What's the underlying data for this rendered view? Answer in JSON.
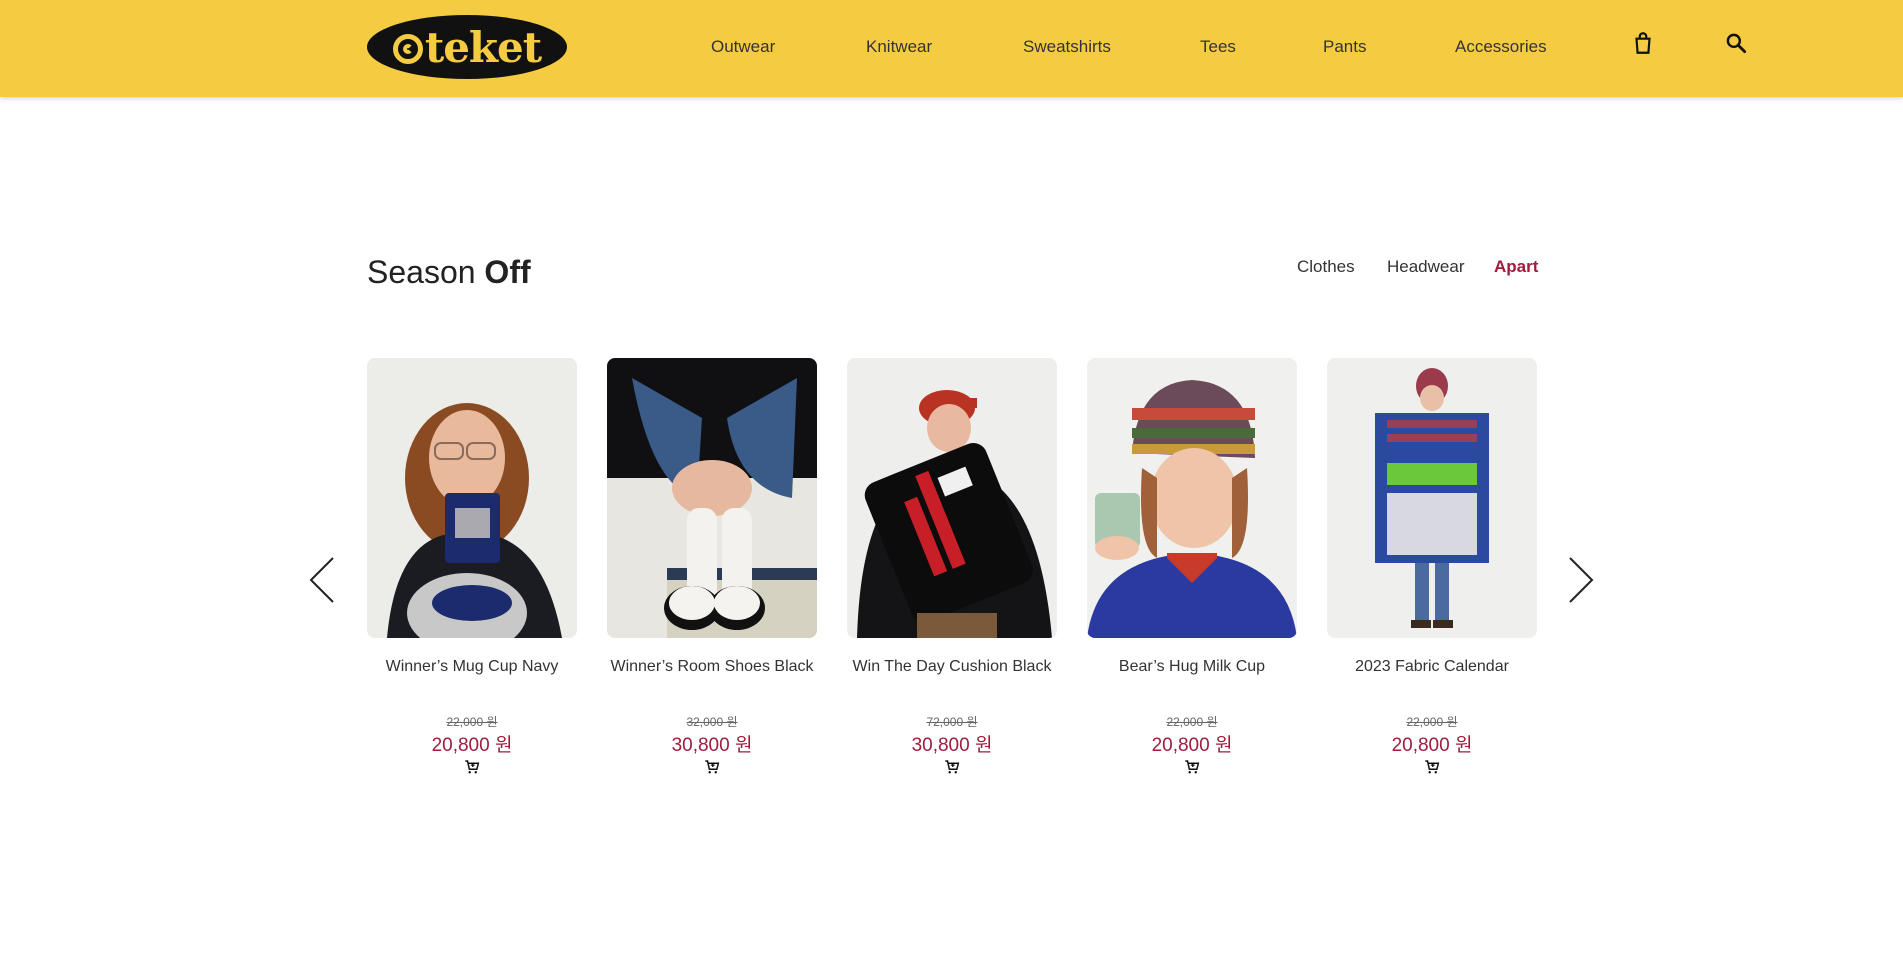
{
  "header": {
    "logo_text": "teket",
    "brand_color": "#f5cb42",
    "nav": [
      "Outwear",
      "Knitwear",
      "Sweatshirts",
      "Tees",
      "Pants",
      "Accessories"
    ],
    "icons": [
      "shopping-bag-icon",
      "search-icon"
    ]
  },
  "section": {
    "title_light": "Season",
    "title_bold": "Off",
    "tabs": [
      {
        "label": "Clothes",
        "active": false
      },
      {
        "label": "Headwear",
        "active": false
      },
      {
        "label": "Apart",
        "active": true
      }
    ],
    "accent_color": "#a21a3c"
  },
  "products": [
    {
      "name": "Winner’s Mug Cup Navy",
      "old_price": "22,000 원",
      "price": "20,800 원"
    },
    {
      "name": "Winner’s Room Shoes Black",
      "old_price": "32,000 원",
      "price": "30,800 원"
    },
    {
      "name": "Win The Day Cushion Black",
      "old_price": "72,000 원",
      "price": "30,800 원"
    },
    {
      "name": "Bear’s Hug Milk Cup",
      "old_price": "22,000 원",
      "price": "20,800 원"
    },
    {
      "name": "2023 Fabric Calendar",
      "old_price": "22,000 원",
      "price": "20,800 원"
    }
  ]
}
